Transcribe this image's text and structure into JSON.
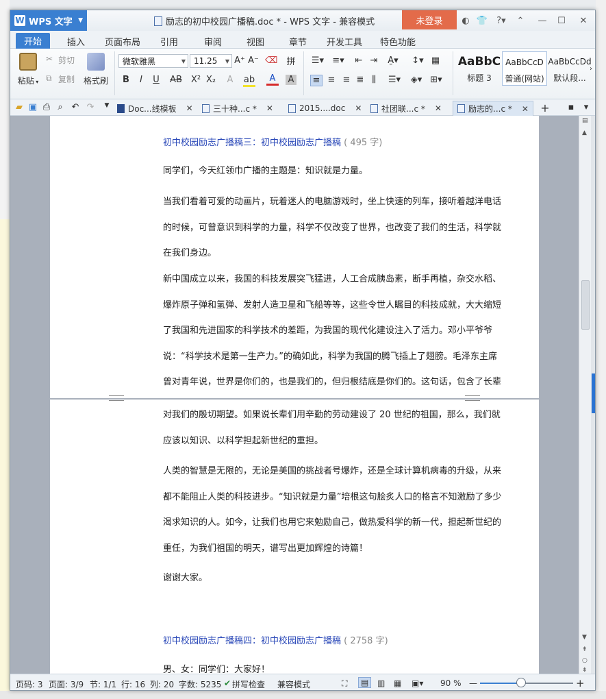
{
  "app": {
    "name": "WPS 文字",
    "title": "励志的初中校园广播稿.doc * - WPS 文字 - 兼容模式",
    "login": "未登录"
  },
  "ribbon_tabs": [
    "开始",
    "插入",
    "页面布局",
    "引用",
    "审阅",
    "视图",
    "章节",
    "开发工具",
    "特色功能"
  ],
  "ribbon": {
    "paste": "粘贴",
    "cut": "剪切",
    "copy": "复制",
    "format_painter": "格式刷",
    "font_name": "微软雅黑",
    "font_size": "11.25",
    "styles": [
      {
        "sample": "AaBbC",
        "name": "标题 3"
      },
      {
        "sample": "AaBbCcD",
        "name": "普通(网站)"
      },
      {
        "sample": "AaBbCcDd",
        "name": "默认段..."
      }
    ]
  },
  "doc_tabs": [
    {
      "label": "Doc...线模板",
      "active": false
    },
    {
      "label": "三十种...c *",
      "active": false
    },
    {
      "label": "2015....doc",
      "active": false
    },
    {
      "label": "社团联...c *",
      "active": false
    },
    {
      "label": "励志的...c *",
      "active": true
    }
  ],
  "document": {
    "heading3": {
      "title": "初中校园励志广播稿三：初中校园励志广播稿",
      "count": "( 495 字)"
    },
    "p1": "同学们，今天红领巾广播的主题是：知识就是力量。",
    "p2": "当我们看着可爱的动画片，玩着迷人的电脑游戏时，坐上快速的列车，接听着越洋电话的时候，可曾意识到科学的力量，科学不仅改变了世界，也改变了我们的生活，科学就在我们身边。",
    "p3_top": "新中国成立以来，我国的科技发展突飞猛进，人工合成胰岛素，断手再植，杂交水稻、爆炸原子弹和氢弹、发射人造卫星和飞船等等，这些令世人瞩目的科技成就，大大缩短了我国和先进国家的科学技术的差距，为我国的现代化建设注入了活力。邓小平爷爷说：“科学技术是第一生产力。”的确如此，科学为我国的腾飞插上了翅膀。毛泽东主席曾对青年说，世界是你们的，也是我们的，但归根结底是你们的。这句话，包含了长辈们",
    "p3_bottom": "对我们的殷切期望。如果说长辈们用辛勤的劳动建设了 20 世纪的祖国，那么，我们就应该以知识、以科学担起新世纪的重担。",
    "p4": "人类的智慧是无限的，无论是美国的挑战者号爆炸，还是全球计算机病毒的升级，从来都不能阻止人类的科技进步。“知识就是力量”培根这句脍炙人口的格言不知激励了多少渴求知识的人。如今，让我们也用它来勉励自己，做热爱科学的新一代，担起新世纪的重任，为我们祖国的明天，谱写出更加辉煌的诗篇！",
    "p5": "谢谢大家。",
    "heading4": {
      "title": "初中校园励志广播稿四：初中校园励志广播稿",
      "count": "( 2758 字)"
    },
    "p6": "男、女：同学们：大家好！"
  },
  "status": {
    "page": "页码: 3",
    "pages": "页面: 3/9",
    "section": "节: 1/1",
    "row": "行: 16",
    "col": "列: 20",
    "words": "字数: 5235",
    "spell": "拼写检查",
    "compat": "兼容模式",
    "zoom": "90 %",
    "zoom_fraction": 0.44
  },
  "colors": {
    "accent": "#3a7fd1",
    "login": "#e36b4a",
    "heading": "#2a48b8"
  }
}
